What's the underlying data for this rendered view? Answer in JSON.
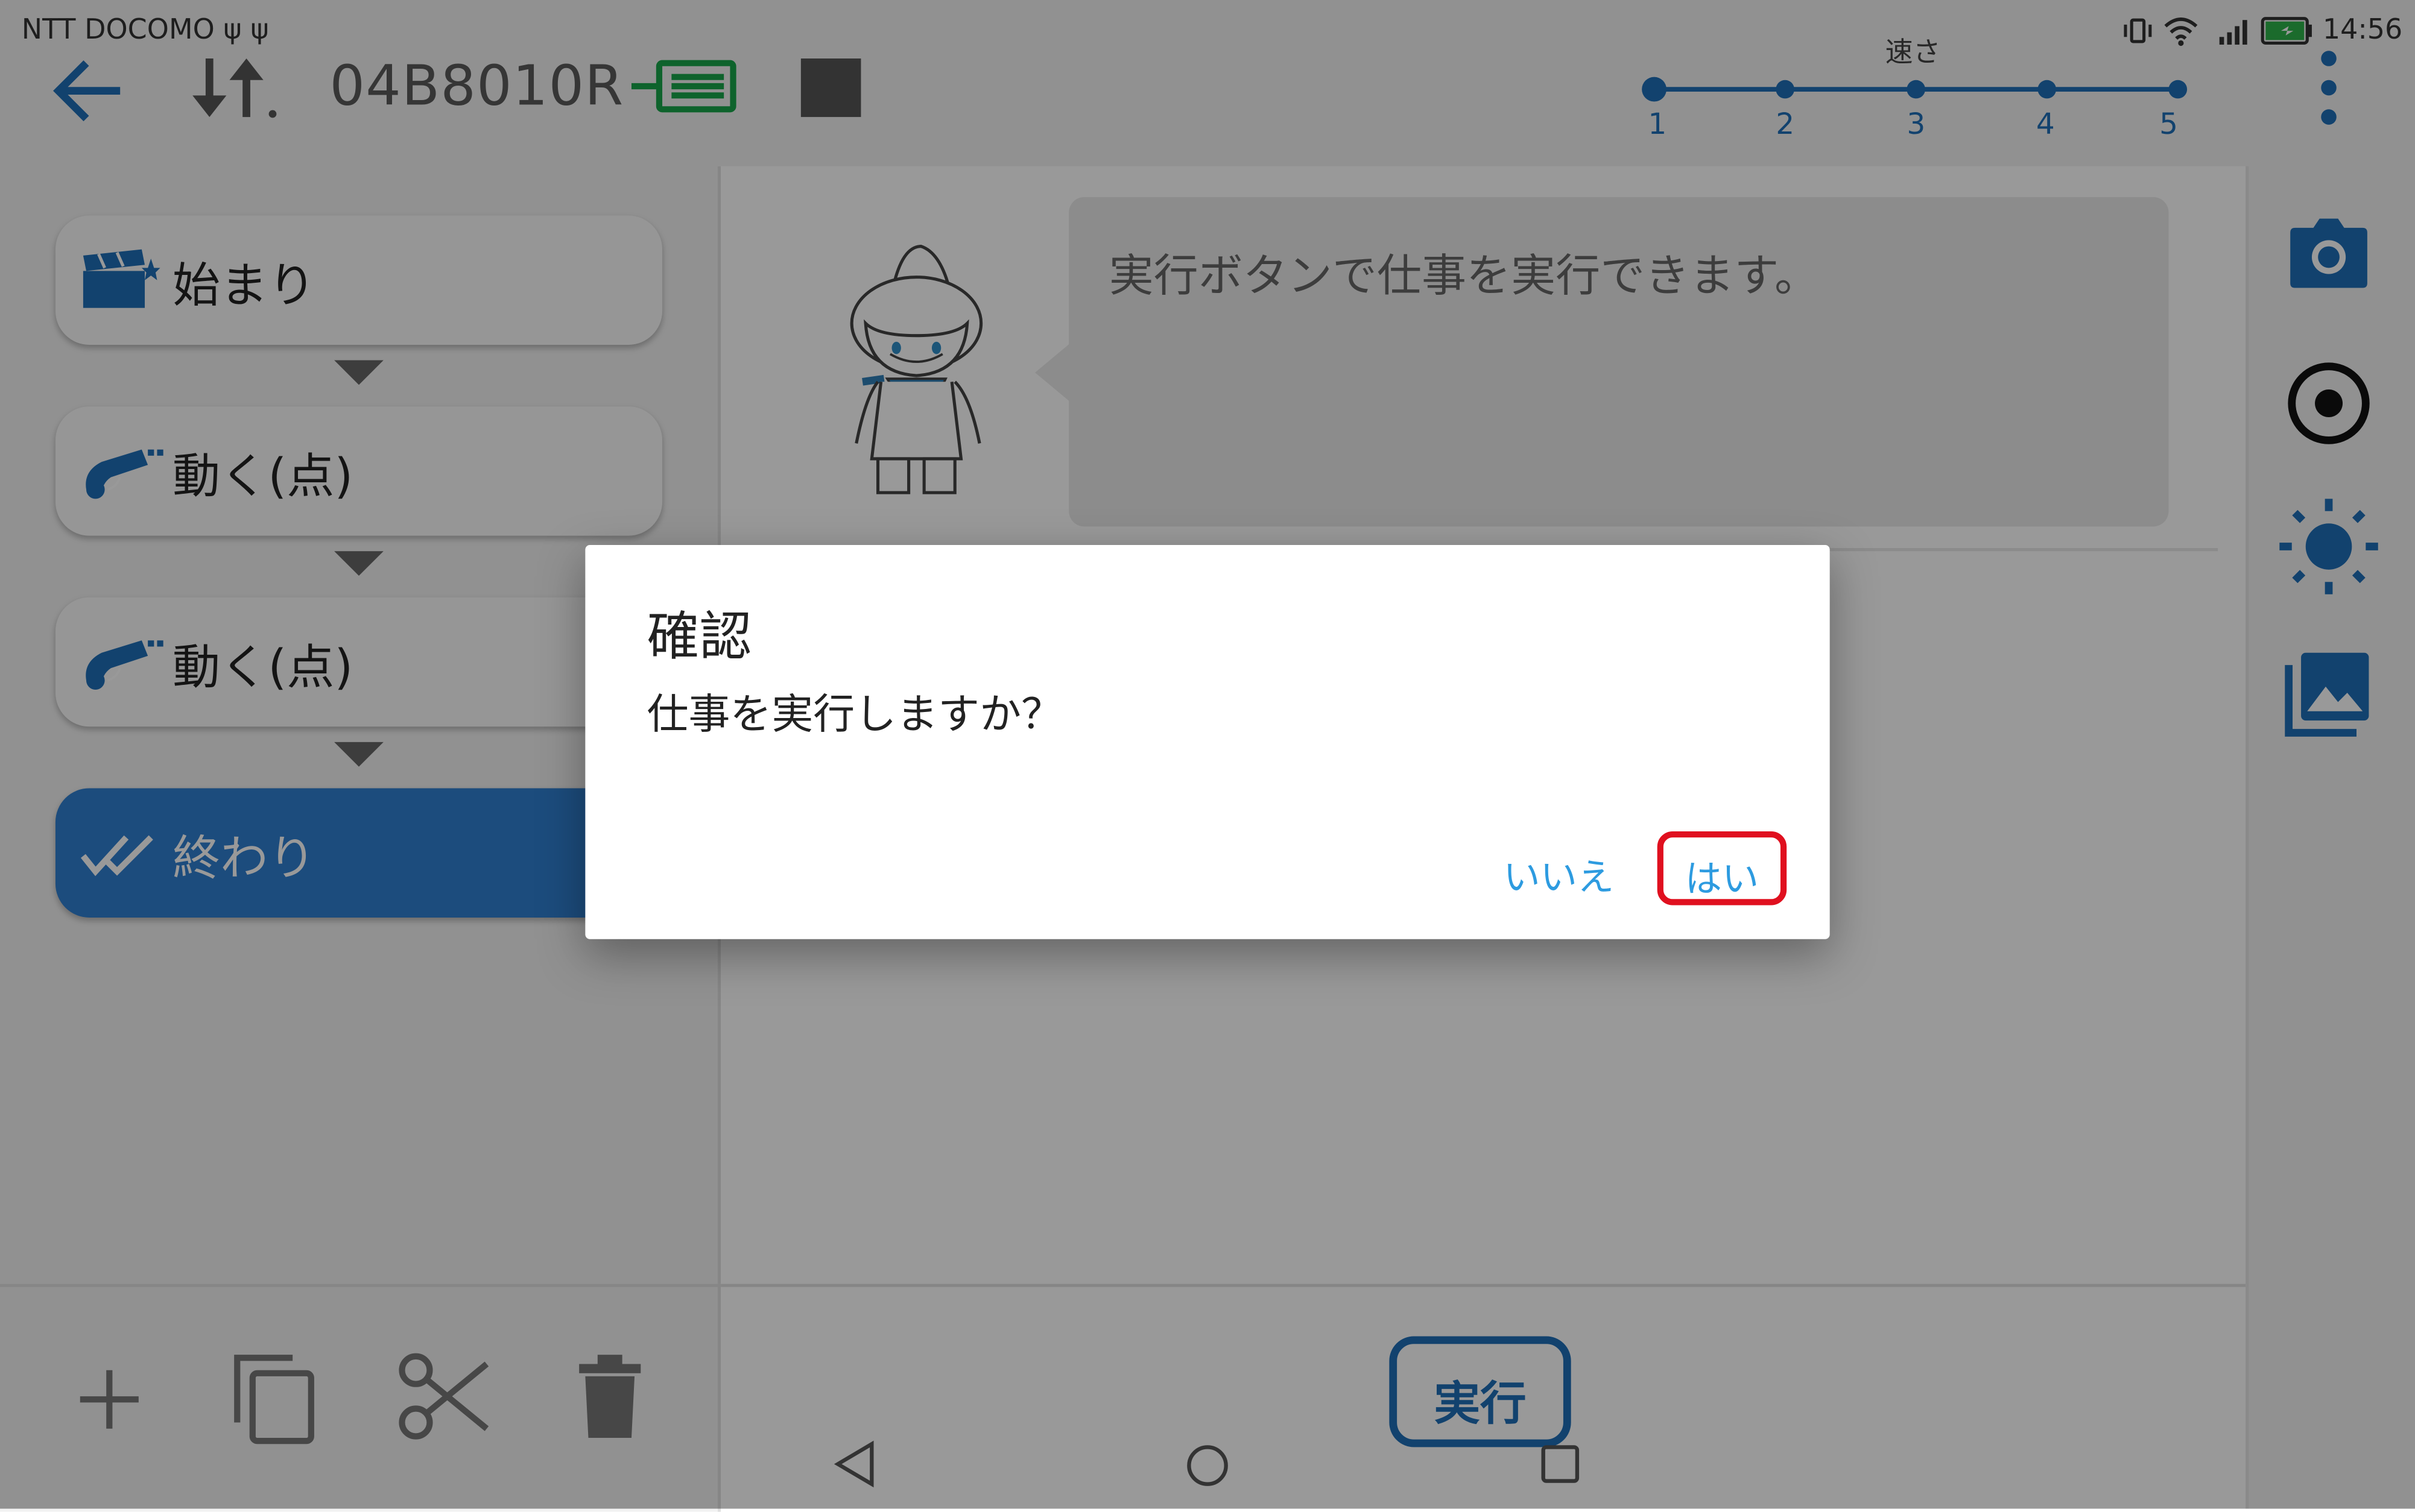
{
  "status_bar": {
    "carrier": "NTT DOCOMO ψ ψ",
    "time": "14:56"
  },
  "header": {
    "robot_id": "04B8010R",
    "speed": {
      "label": "速さ",
      "levels": [
        "1",
        "2",
        "3",
        "4",
        "5"
      ],
      "selected": "1"
    }
  },
  "program": {
    "blocks": [
      {
        "label": "始まり",
        "icon": "clapperboard-icon"
      },
      {
        "label": "動く(点)",
        "icon": "robot-arm-icon"
      },
      {
        "label": "動く(点)",
        "icon": "robot-arm-icon"
      },
      {
        "label": "終わり",
        "icon": "double-check-icon",
        "active": true
      }
    ]
  },
  "guide": {
    "message": "実行ボタンで仕事を実行できます。"
  },
  "run_button": {
    "label": "実行"
  },
  "dialog": {
    "title": "確認",
    "message": "仕事を実行しますか？",
    "no_label": "いいえ",
    "yes_label": "はい"
  },
  "colors": {
    "accent": "#1f6fb8",
    "dialog_button": "#2d9be0",
    "highlight": "#e0101f",
    "battery": "#2db34a",
    "status_green": "#18a54a"
  }
}
